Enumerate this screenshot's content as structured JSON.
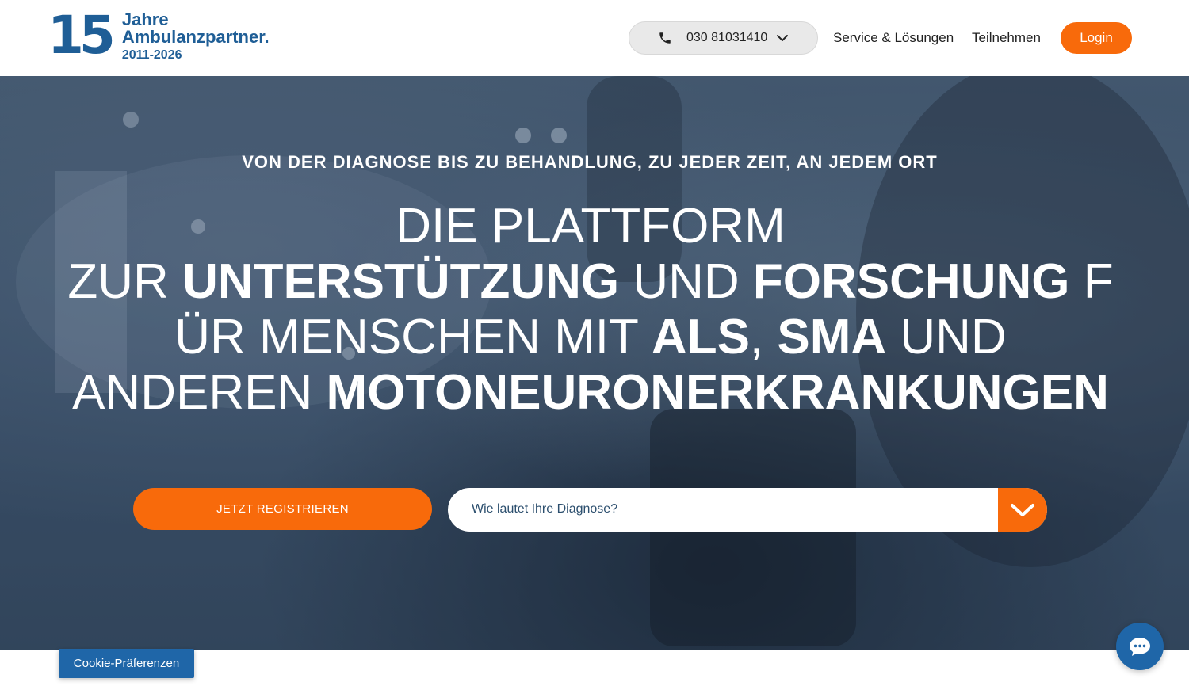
{
  "logo": {
    "number": "15",
    "line1": "Jahre",
    "line2": "Ambulanzpartner.",
    "line3": "2011-2026"
  },
  "header": {
    "phone": "030 81031410",
    "nav": [
      {
        "label": "Service & Lösungen"
      },
      {
        "label": "Teilnehmen"
      }
    ],
    "login_label": "Login"
  },
  "hero": {
    "tagline": "VON DER DIAGNOSE BIS ZU BEHANDLUNG, ZU JEDER ZEIT, AN JEDEM ORT",
    "headline": {
      "line1": "DIE PLATTFORM",
      "p1": "ZUR ",
      "b1": "UNTERSTÜTZUNG",
      "p2": " UND ",
      "b2": "FORSCHUNG",
      "p3": " F",
      "p4": "ÜR MENSCHEN MIT ",
      "b3": "ALS",
      "p5": ", ",
      "b4": "SMA",
      "p6": " UND",
      "p7": "ANDEREN ",
      "b5": "MOTONEURONERKRANKUNGEN"
    },
    "register_label": "JETZT REGISTRIEREN",
    "diagnosis_value": "Wie lautet Ihre Diagnose?"
  },
  "cookie_label": "Cookie-Präferenzen",
  "colors": {
    "brand_blue": "#1f5e96",
    "accent_orange": "#f86a0b"
  }
}
